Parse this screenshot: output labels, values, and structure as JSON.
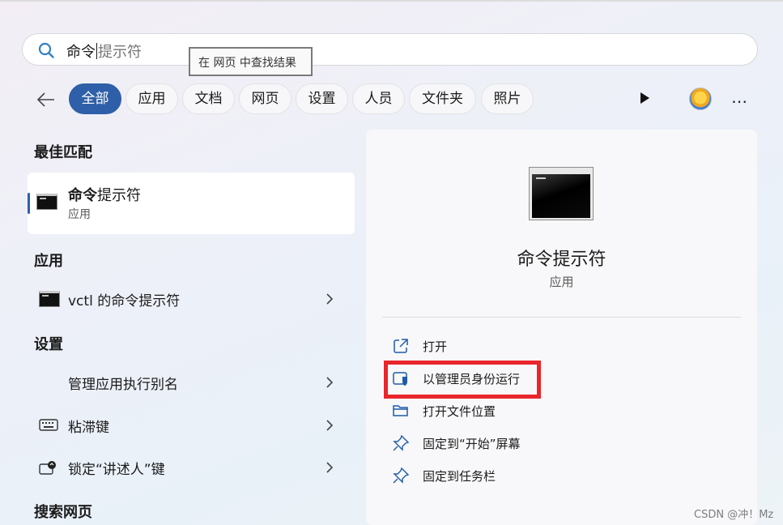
{
  "search": {
    "typed": "命令",
    "suggestion": "提示符",
    "tooltip": "在 网页 中查找结果"
  },
  "filters": [
    "全部",
    "应用",
    "文档",
    "网页",
    "设置",
    "人员",
    "文件夹",
    "照片"
  ],
  "active_filter": "全部",
  "left": {
    "best_match_heading": "最佳匹配",
    "best_match": {
      "title_bold": "命令",
      "title_rest": "提示符",
      "subtitle": "应用"
    },
    "apps_heading": "应用",
    "apps": [
      {
        "label": "vctl 的命令提示符"
      }
    ],
    "settings_heading": "设置",
    "settings": [
      {
        "label": "管理应用执行别名",
        "icon": "none"
      },
      {
        "label": "粘滞键",
        "icon": "keyboard-icon"
      },
      {
        "label": "锁定“讲述人”键",
        "icon": "narrator-icon"
      }
    ],
    "web_heading": "搜索网页"
  },
  "detail": {
    "title": "命令提示符",
    "subtitle": "应用",
    "actions": [
      {
        "label": "打开",
        "icon": "open-external-icon"
      },
      {
        "label": "以管理员身份运行",
        "icon": "admin-shield-icon"
      },
      {
        "label": "打开文件位置",
        "icon": "folder-icon"
      },
      {
        "label": "固定到“开始”屏幕",
        "icon": "pin-icon"
      },
      {
        "label": "固定到任务栏",
        "icon": "pin-icon"
      }
    ]
  },
  "colors": {
    "accent": "#2f5fa8",
    "highlight_box": "#e8262b"
  },
  "watermark": "CSDN @冲！Mz"
}
